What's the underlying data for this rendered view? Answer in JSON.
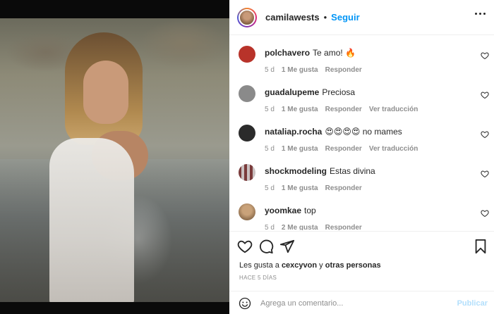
{
  "post": {
    "author": "camilawests",
    "separator": "•",
    "follow_label": "Seguir",
    "more_icon": "more-options-icon"
  },
  "comments": [
    {
      "user": "polchavero",
      "text": "Te amo! 🔥",
      "time": "5 d",
      "likes": "1 Me gusta",
      "reply": "Responder",
      "translate": "",
      "avatar_color": "#b8332a"
    },
    {
      "user": "guadalupeme",
      "text": "Preciosa",
      "time": "5 d",
      "likes": "1 Me gusta",
      "reply": "Responder",
      "translate": "Ver traducción",
      "avatar_color": "#7d7d7d"
    },
    {
      "user": "nataliap.rocha",
      "text": "😍😍😍😍 no mames",
      "time": "5 d",
      "likes": "1 Me gusta",
      "reply": "Responder",
      "translate": "Ver traducción",
      "avatar_color": "#2b2b2b"
    },
    {
      "user": "shockmodeling",
      "text": "Estas divina",
      "time": "5 d",
      "likes": "1 Me gusta",
      "reply": "Responder",
      "translate": "",
      "avatar_color": "#7a3b3b"
    },
    {
      "user": "yoomkae",
      "text": "top",
      "time": "5 d",
      "likes": "2 Me gusta",
      "reply": "Responder",
      "translate": "",
      "avatar_color": "#c9a27a"
    }
  ],
  "likes": {
    "prefix": "Les gusta a ",
    "user": "cexcyvon",
    "conjunction": " y ",
    "others": "otras personas"
  },
  "time_ago": "HACE 5 DÍAS",
  "add_comment": {
    "placeholder": "Agrega un comentario...",
    "publish_label": "Publicar"
  }
}
